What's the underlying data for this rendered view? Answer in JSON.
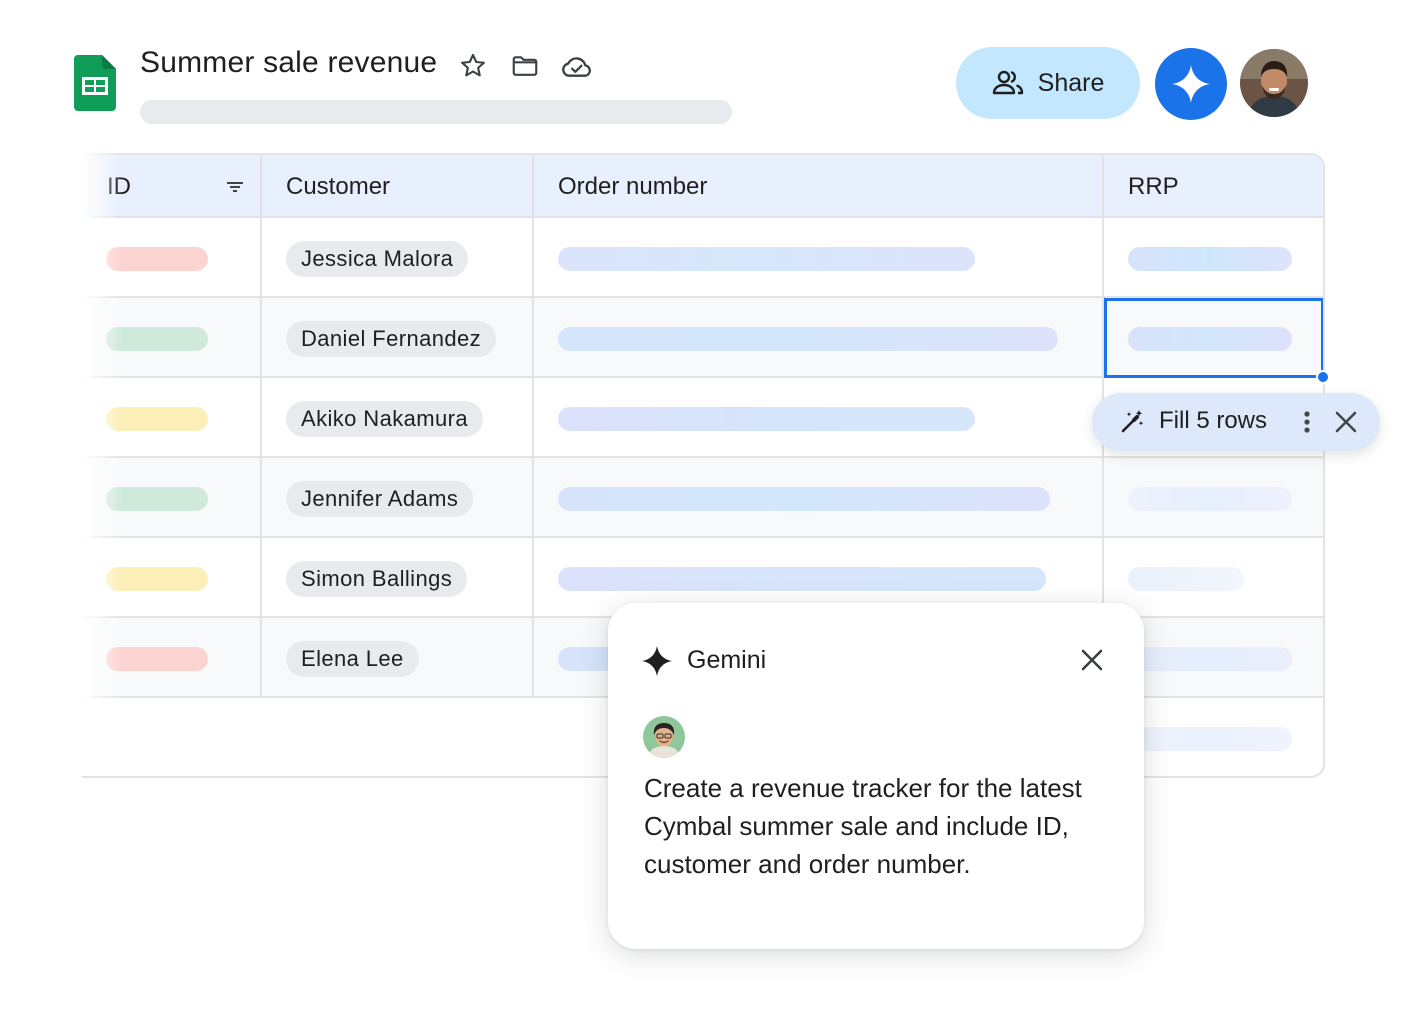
{
  "header": {
    "title": "Summer sale revenue",
    "app_icon": "sheets-icon",
    "title_icons": [
      "star-icon",
      "folder-icon",
      "cloud-done-icon"
    ],
    "share_label": "Share",
    "gemini_button_icon": "gemini-spark-icon",
    "user_avatar": "user-avatar"
  },
  "table": {
    "columns": [
      "ID",
      "Customer",
      "Order number",
      "RRP"
    ],
    "filter_icon": "filter-icon",
    "rows": [
      {
        "id_status": "red",
        "customer": "Jessica Malora"
      },
      {
        "id_status": "green",
        "customer": "Daniel Fernandez"
      },
      {
        "id_status": "yellow",
        "customer": "Akiko Nakamura"
      },
      {
        "id_status": "green",
        "customer": "Jennifer Adams"
      },
      {
        "id_status": "yellow",
        "customer": "Simon Ballings"
      },
      {
        "id_status": "red",
        "customer": "Elena Lee"
      }
    ],
    "status_colors": {
      "red": "#fbd3d0",
      "green": "#cfeadb",
      "yellow": "#fdefb8"
    },
    "selected_cell": "RRP row 2"
  },
  "fill_popup": {
    "label": "Fill 5 rows",
    "icons": [
      "magic-wand-icon",
      "more-vert-icon",
      "close-icon"
    ]
  },
  "gemini_panel": {
    "title": "Gemini",
    "prompt": "Create a revenue tracker for the latest Cymbal summer sale and include ID, customer and order number."
  },
  "colors": {
    "accent": "#1a73e8",
    "share_bg": "#c2e7ff",
    "header_bg": "#e8effd",
    "sheets_green": "#0f9d58"
  }
}
